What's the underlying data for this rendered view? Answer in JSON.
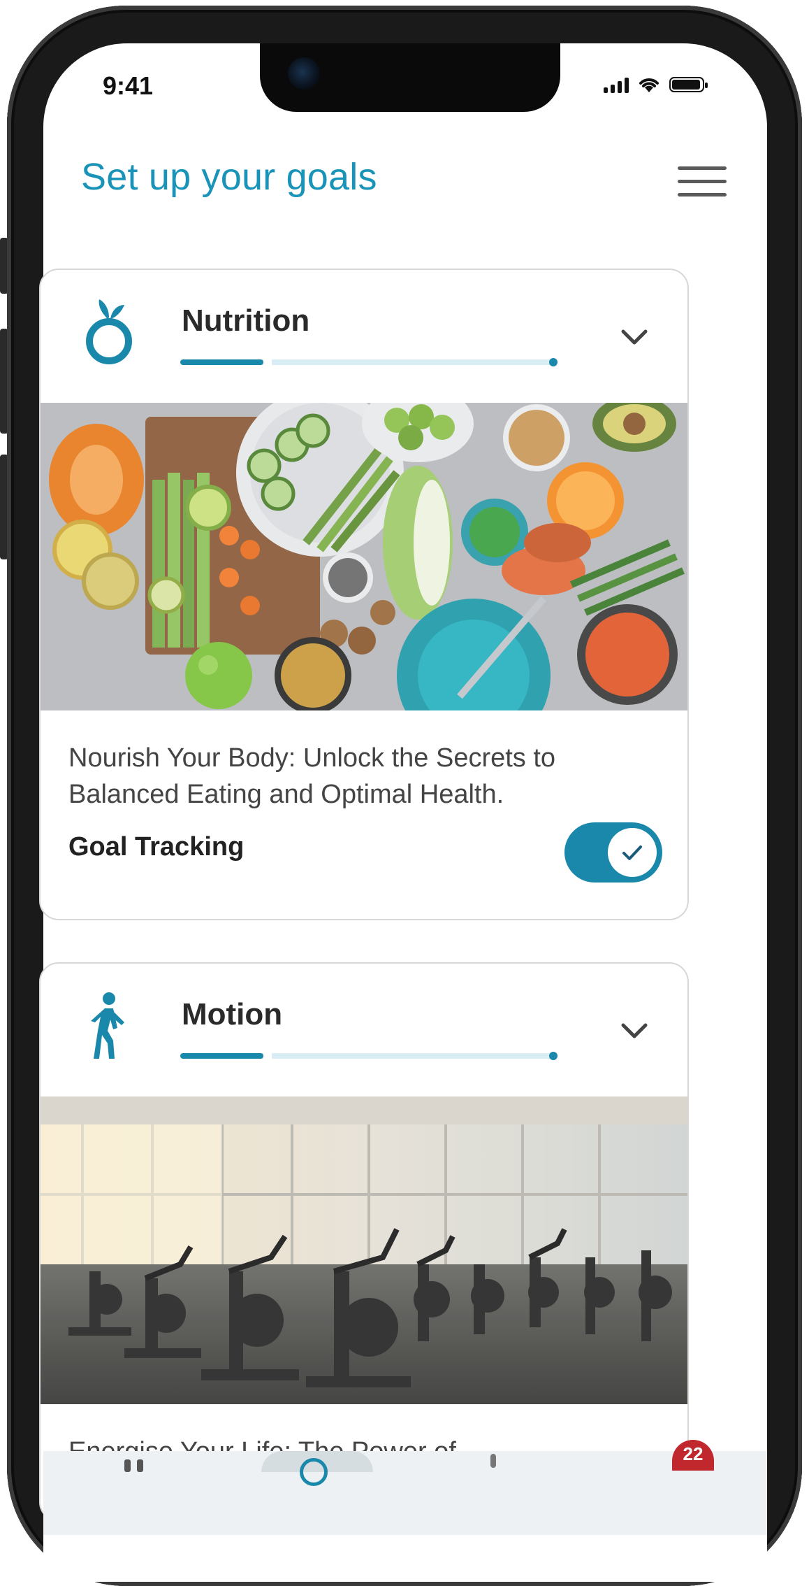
{
  "status": {
    "time": "9:41"
  },
  "header": {
    "title": "Set up your goals"
  },
  "cards": [
    {
      "title": "Nutrition",
      "progress": 0.22,
      "description": "Nourish Your Body: Unlock the Secrets to Balanced Eating and Optimal Health.",
      "goal_label": "Goal Tracking",
      "goal_tracking": true,
      "icon": "nutrition-icon"
    },
    {
      "title": "Motion",
      "progress": 0.22,
      "description": "Energise Your Life: The Power of",
      "icon": "walking-person-icon"
    }
  ],
  "nav": {
    "badge": "22"
  },
  "colors": {
    "accent": "#1a93b8",
    "toggle": "#1a88ab",
    "progress_track": "#d9eef4"
  }
}
